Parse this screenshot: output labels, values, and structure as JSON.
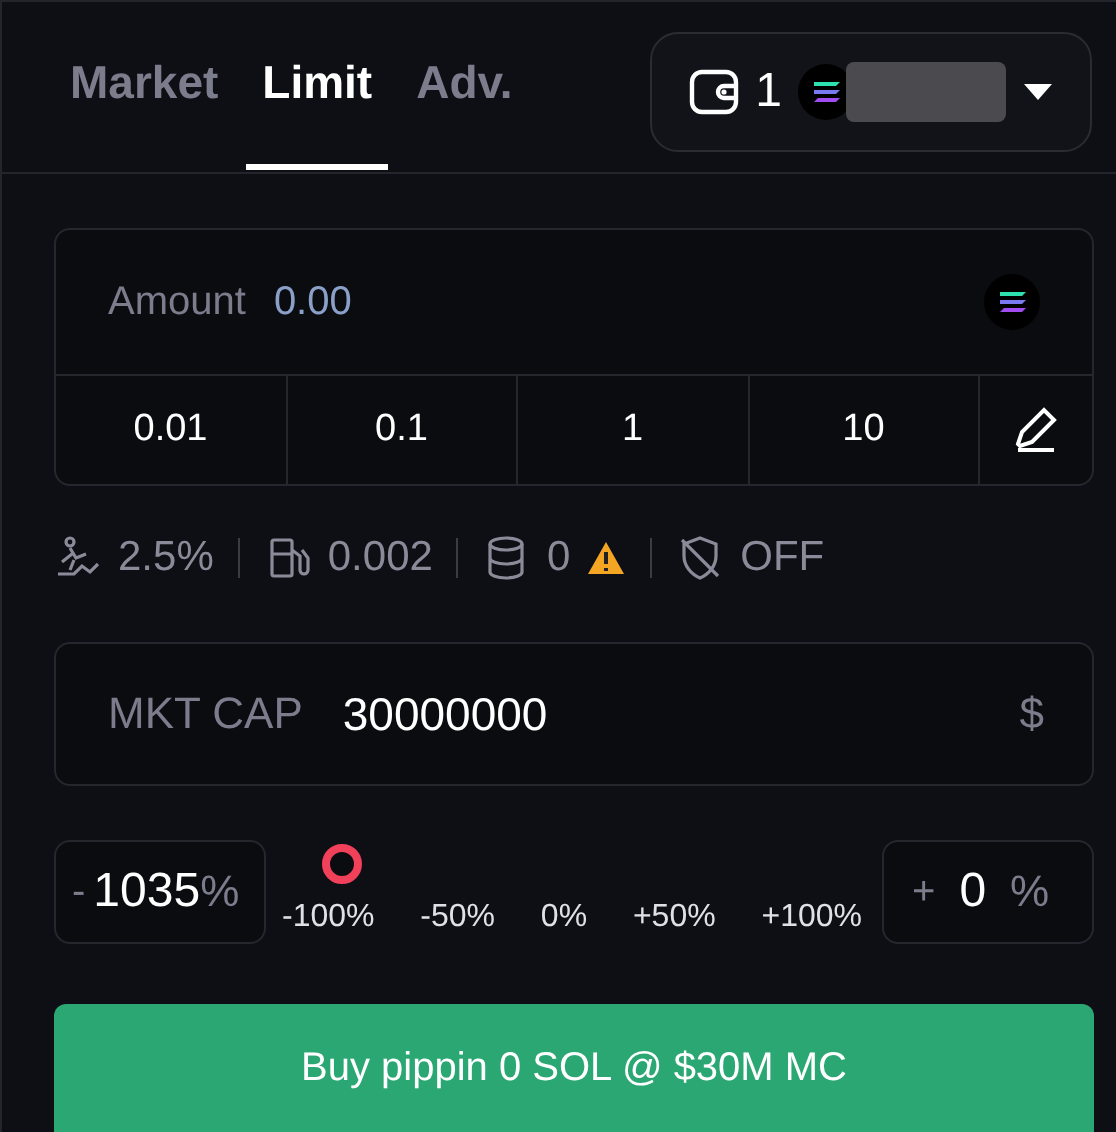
{
  "tabs": [
    {
      "label": "Market",
      "selected": false
    },
    {
      "label": "Limit",
      "selected": true
    },
    {
      "label": "Adv.",
      "selected": false
    }
  ],
  "wallet": {
    "count": "1"
  },
  "amount": {
    "label": "Amount",
    "placeholder": "0.00"
  },
  "presets": [
    "0.01",
    "0.1",
    "1",
    "10"
  ],
  "stats": [
    {
      "kind": "slippage",
      "value": "2.5%"
    },
    {
      "kind": "fee",
      "value": "0.002"
    },
    {
      "kind": "tip",
      "value": "0",
      "warning": true
    },
    {
      "kind": "protection",
      "value": "OFF"
    }
  ],
  "mktcap": {
    "label": "MKT CAP",
    "value": "30000000",
    "unit": "$"
  },
  "left_field": {
    "sign": "-",
    "value": "1035",
    "unit": "%"
  },
  "slider": {
    "labels": [
      "-100%",
      "-50%",
      "0%",
      "+50%",
      "+100%"
    ]
  },
  "right_field": {
    "sign": "+",
    "value": "0",
    "unit": "%"
  },
  "buy_button": "Buy pippin 0 SOL @ $30M MC"
}
